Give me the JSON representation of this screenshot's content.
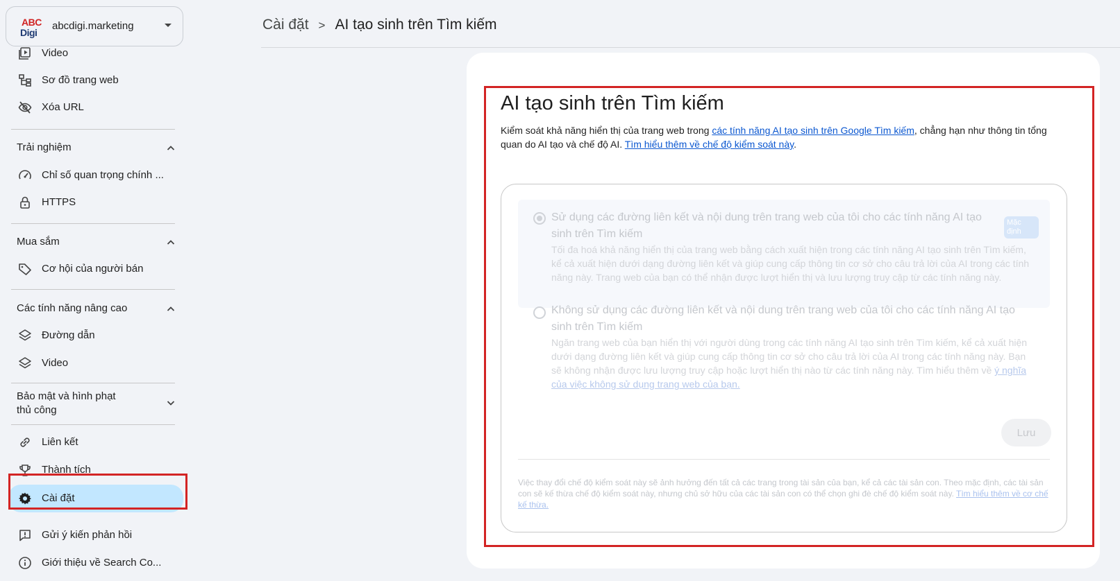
{
  "property": {
    "logo_top": "ABC",
    "logo_bottom": "Digi",
    "name": "abcdigi.marketing"
  },
  "breadcrumb": {
    "parent": "Cài đặt",
    "separator": ">",
    "current": "AI tạo sinh trên Tìm kiếm"
  },
  "sidebar": {
    "items_top": [
      {
        "label": "Video",
        "icon": "video-library-icon"
      },
      {
        "label": "Sơ đồ trang web",
        "icon": "sitemap-icon"
      },
      {
        "label": "Xóa URL",
        "icon": "eye-off-icon"
      }
    ],
    "section_experience": "Trải nghiệm",
    "items_experience": [
      {
        "label": "Chỉ số quan trọng chính ...",
        "icon": "speedometer-icon"
      },
      {
        "label": "HTTPS",
        "icon": "lock-icon"
      }
    ],
    "section_shopping": "Mua sắm",
    "items_shopping": [
      {
        "label": "Cơ hội của người bán",
        "icon": "tag-icon"
      }
    ],
    "section_advanced": "Các tính năng nâng cao",
    "items_advanced": [
      {
        "label": "Đường dẫn",
        "icon": "layers-icon"
      },
      {
        "label": "Video",
        "icon": "layers-icon"
      }
    ],
    "section_security": "Bảo mật và hình phạt thủ công",
    "items_bottom": [
      {
        "label": "Liên kết",
        "icon": "link-icon"
      },
      {
        "label": "Thành tích",
        "icon": "trophy-icon"
      },
      {
        "label": "Cài đặt",
        "icon": "gear-icon"
      },
      {
        "label": "Gửi ý kiến phản hồi",
        "icon": "feedback-icon"
      },
      {
        "label": "Giới thiệu về Search Co...",
        "icon": "info-icon"
      }
    ]
  },
  "main": {
    "title": "AI tạo sinh trên Tìm kiếm",
    "desc_part1": "Kiểm soát khả năng hiển thị của trang web trong ",
    "desc_link1": "các tính năng AI tạo sinh trên Google Tìm kiếm",
    "desc_part2": ", chẳng hạn như thông tin tổng quan do AI tạo và chế độ AI. ",
    "desc_link2": "Tìm hiểu thêm về chế độ kiểm soát này",
    "desc_part3": ".",
    "option1": {
      "title": "Sử dụng các đường liên kết và nội dung trên trang web của tôi cho các tính năng AI tạo sinh trên Tìm kiếm",
      "desc": "Tối đa hoá khả năng hiển thị của trang web bằng cách xuất hiện trong các tính năng AI tạo sinh trên Tìm kiếm, kể cả xuất hiện dưới dạng đường liên kết và giúp cung cấp thông tin cơ sở cho câu trả lời của AI trong các tính năng này. Trang web của bạn có thể nhận được lượt hiển thị và lưu lượng truy cập từ các tính năng này.",
      "badge": "Mặc định",
      "selected": true
    },
    "option2": {
      "title": "Không sử dụng các đường liên kết và nội dung trên trang web của tôi cho các tính năng AI tạo sinh trên Tìm kiếm",
      "desc": "Ngăn trang web của bạn hiển thị với người dùng trong các tính năng AI tạo sinh trên Tìm kiếm, kể cả xuất hiện dưới dạng đường liên kết và giúp cung cấp thông tin cơ sở cho câu trả lời của AI trong các tính năng này. Bạn sẽ không nhận được lưu lượng truy cập hoặc lượt hiển thị nào từ các tính năng này. Tìm hiểu thêm về ",
      "link": "ý nghĩa của việc không sử dụng trang web của bạn.",
      "selected": false
    },
    "save_label": "Lưu",
    "footnote": "Việc thay đổi chế độ kiểm soát này sẽ ảnh hưởng đến tất cả các trang trong tài sản của bạn, kể cả các tài sản con. Theo mặc định, các tài sản con sẽ kế thừa chế độ kiểm soát này, nhưng chủ sở hữu của các tài sản con có thể chọn ghi đè chế độ kiểm soát này. ",
    "footnote_link": "Tìm hiểu thêm về cơ chế kế thừa."
  },
  "colors": {
    "highlight": "#d32424",
    "active_nav": "#c2e7ff",
    "link": "#0b57d0"
  }
}
